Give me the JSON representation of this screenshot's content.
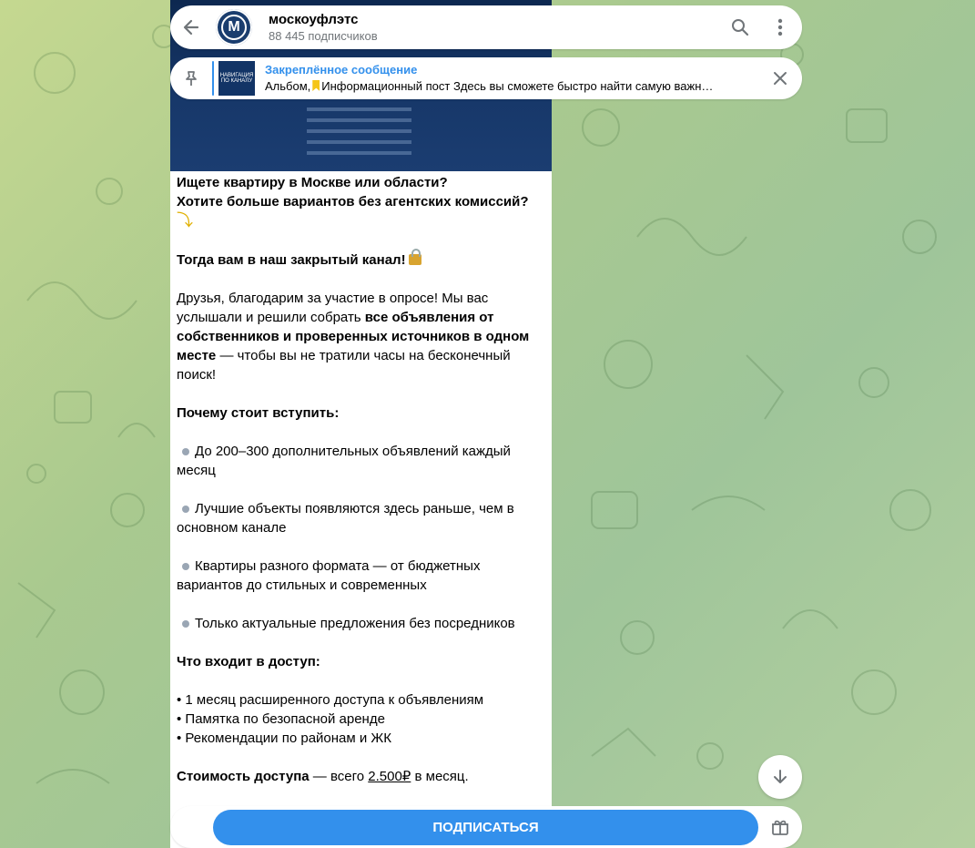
{
  "header": {
    "title": "москоуфлэтс",
    "subscribers": "88 445 подписчиков",
    "avatar_letter": "M",
    "icons": [
      "back-arrow-icon",
      "search-icon",
      "more-vertical-icon"
    ]
  },
  "pinned": {
    "title": "Закреплённое сообщение",
    "preview_prefix": "Альбом,",
    "preview_text": "Информационный пост Здесь вы сможете быстро найти самую важн…",
    "thumb_text": "НАВИГАЦИЯ ПО КАНАЛУ",
    "icons": [
      "pin-icon",
      "bookmark-icon",
      "close-icon"
    ]
  },
  "message": {
    "q1": "Ищете квартиру в Москве или области?",
    "q2": "Хотите больше вариантов без агентских комиссий?",
    "arrow": "⤵",
    "cta_bold": "Тогда вам в наш закрытый канал!",
    "para_a": "Друзья, благодарим за участие в опросе! Мы вас услышали и решили собрать",
    "para_b_bold": "все объявления от собственников и проверенных источников в одном месте",
    "para_c": "— чтобы вы не тратили часы на бесконечный поиск!",
    "why_heading": "Почему стоит вступить:",
    "why_items": [
      "До 200–300 дополнительных объявлений каждый месяц",
      "Лучшие объекты появляются здесь раньше, чем в основном канале",
      "Квартиры разного формата — от бюджетных вариантов до стильных и современных",
      "Только актуальные предложения без посредников"
    ],
    "includes_heading": "Что входит в доступ:",
    "includes_items": [
      "• 1 месяц расширенного доступа к объявлениям",
      "• Памятка по безопасной аренде",
      "• Рекомендации по районам и ЖК"
    ],
    "price_bold": "Стоимость доступа",
    "price_mid": "— всего",
    "price_value": "2.500₽",
    "price_tail": "в месяц."
  },
  "bottom": {
    "subscribe_label": "ПОДПИСАТЬСЯ",
    "icons": [
      "gift-icon",
      "arrow-down-icon"
    ]
  },
  "colors": {
    "accent": "#3390ec",
    "secondary_text": "#707579",
    "image_blue": "#17386a"
  }
}
